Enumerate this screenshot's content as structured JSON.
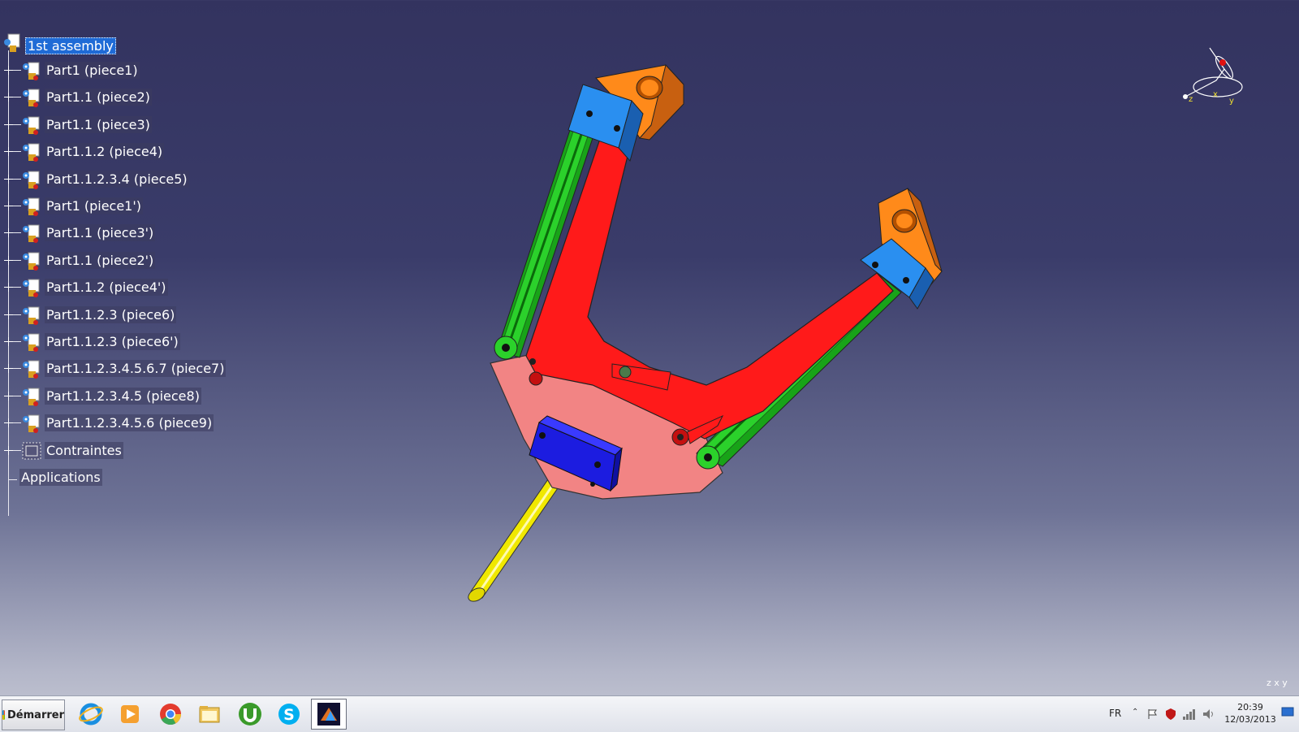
{
  "tree": {
    "root": "1st assembly",
    "nodes": [
      {
        "label": "Part1 (piece1)"
      },
      {
        "label": "Part1.1 (piece2)"
      },
      {
        "label": "Part1.1 (piece3)"
      },
      {
        "label": "Part1.1.2 (piece4)"
      },
      {
        "label": "Part1.1.2.3.4 (piece5)"
      },
      {
        "label": "Part1 (piece1')"
      },
      {
        "label": "Part1.1 (piece3')"
      },
      {
        "label": "Part1.1 (piece2')"
      },
      {
        "label": "Part1.1.2 (piece4')"
      },
      {
        "label": "Part1.1.2.3 (piece6)"
      },
      {
        "label": "Part1.1.2.3 (piece6')"
      },
      {
        "label": "Part1.1.2.3.4.5.6.7 (piece7)"
      },
      {
        "label": "Part1.1.2.3.4.5 (piece8)"
      },
      {
        "label": "Part1.1.2.3.4.5.6 (piece9)"
      }
    ],
    "constraints": "Contraintes",
    "applications": "Applications"
  },
  "compass": {
    "axes": [
      "z",
      "x",
      "y"
    ]
  },
  "mini_axes": "z x y",
  "taskbar": {
    "start_label": "Démarrer",
    "apps": [
      "internet-explorer-icon",
      "media-player-icon",
      "chrome-icon",
      "file-explorer-icon",
      "utorrent-icon",
      "skype-icon",
      "catia-icon"
    ],
    "language": "FR",
    "time": "20:39",
    "date": "12/03/2013"
  },
  "colors": {
    "bg_top": "#33335f",
    "bg_bottom": "#c6c8d4",
    "selection": "#1f6bd6",
    "part_red": "#ff1a1a",
    "part_green": "#1fb51f",
    "part_orange": "#ff8a1a",
    "part_blue": "#2a8ff0",
    "part_darkblue": "#1c1ce0",
    "part_yellow": "#f0e800",
    "part_pink": "#f08a8a"
  }
}
